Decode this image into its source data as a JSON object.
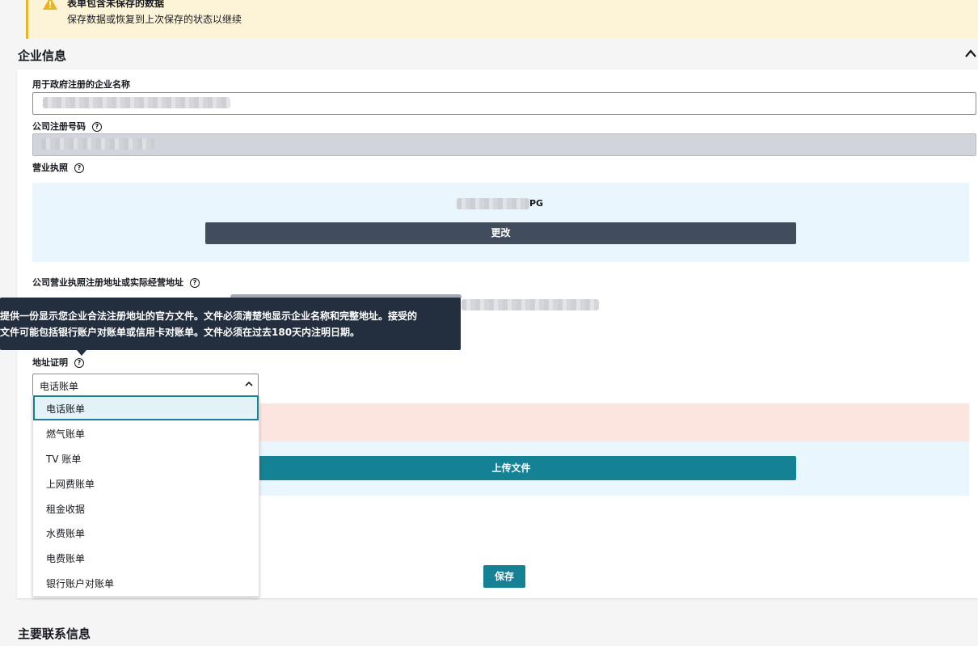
{
  "banner": {
    "title": "表单包含未保存的数据",
    "subtitle": "保存数据或恢复到上次保存的状态以继续",
    "icon": "warning-icon"
  },
  "section": {
    "title": "企业信息",
    "next_title": "主要联系信息"
  },
  "fields": {
    "company_name_label": "用于政府注册的企业名称",
    "reg_number_label": "公司注册号码",
    "license_label": "营业执照",
    "license_file_suffix": "PG",
    "change_button": "更改",
    "address_label": "公司营业执照注册地址或实际经营地址",
    "address_proof_label": "地址证明",
    "upload_button": "上传文件",
    "save_button": "保存"
  },
  "tooltip": {
    "line1": "提供一份显示您企业合法注册地址的官方文件。文件必须清楚地显示企业名称和完整地址。接受的",
    "line2": "文件可能包括银行账户对账单或信用卡对账单。文件必须在过去180天内注明日期。"
  },
  "select": {
    "selected": "电话账单",
    "options": [
      "电话账单",
      "燃气账单",
      "TV 账单",
      "上网费账单",
      "租金收据",
      "水费账单",
      "电费账单",
      "银行账户对账单"
    ]
  },
  "colors": {
    "accent": "#148195",
    "warning": "#e8b521",
    "banner_bg": "#fdf3d7",
    "tooltip_bg": "#232f3e",
    "dark_button": "#414d5c"
  }
}
